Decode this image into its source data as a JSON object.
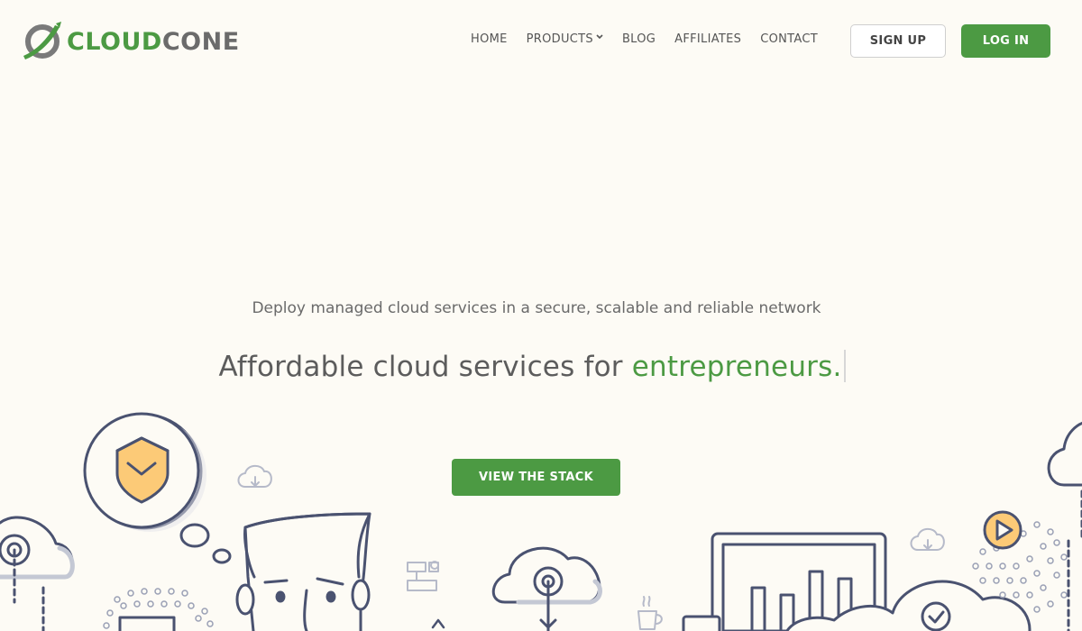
{
  "brand": {
    "name_part1": "CLOUD",
    "name_part2": "CONE",
    "accent_color": "#4c9a43",
    "logo_icon": "cloudcone-logo-icon"
  },
  "nav": {
    "items": [
      {
        "label": "HOME"
      },
      {
        "label": "PRODUCTS",
        "has_dropdown": true,
        "icon": "chevron-down-icon"
      },
      {
        "label": "BLOG"
      },
      {
        "label": "AFFILIATES"
      },
      {
        "label": "CONTACT"
      }
    ]
  },
  "auth": {
    "signup_label": "SIGN UP",
    "login_label": "LOG IN"
  },
  "hero": {
    "subtitle": "Deploy managed cloud services in a secure, scalable and reliable network",
    "title_prefix": "Affordable cloud services for ",
    "title_accent": "entrepreneurs.",
    "cta_label": "VIEW THE STACK"
  },
  "illustration": {
    "icons": [
      "shield-check-icon",
      "cloud-download-icon",
      "man-face-illustration",
      "cloud-upload-icon",
      "flowchart-icon",
      "coffee-cup-icon",
      "monitor-chart-illustration",
      "play-button-icon",
      "cloud-check-icon"
    ]
  }
}
